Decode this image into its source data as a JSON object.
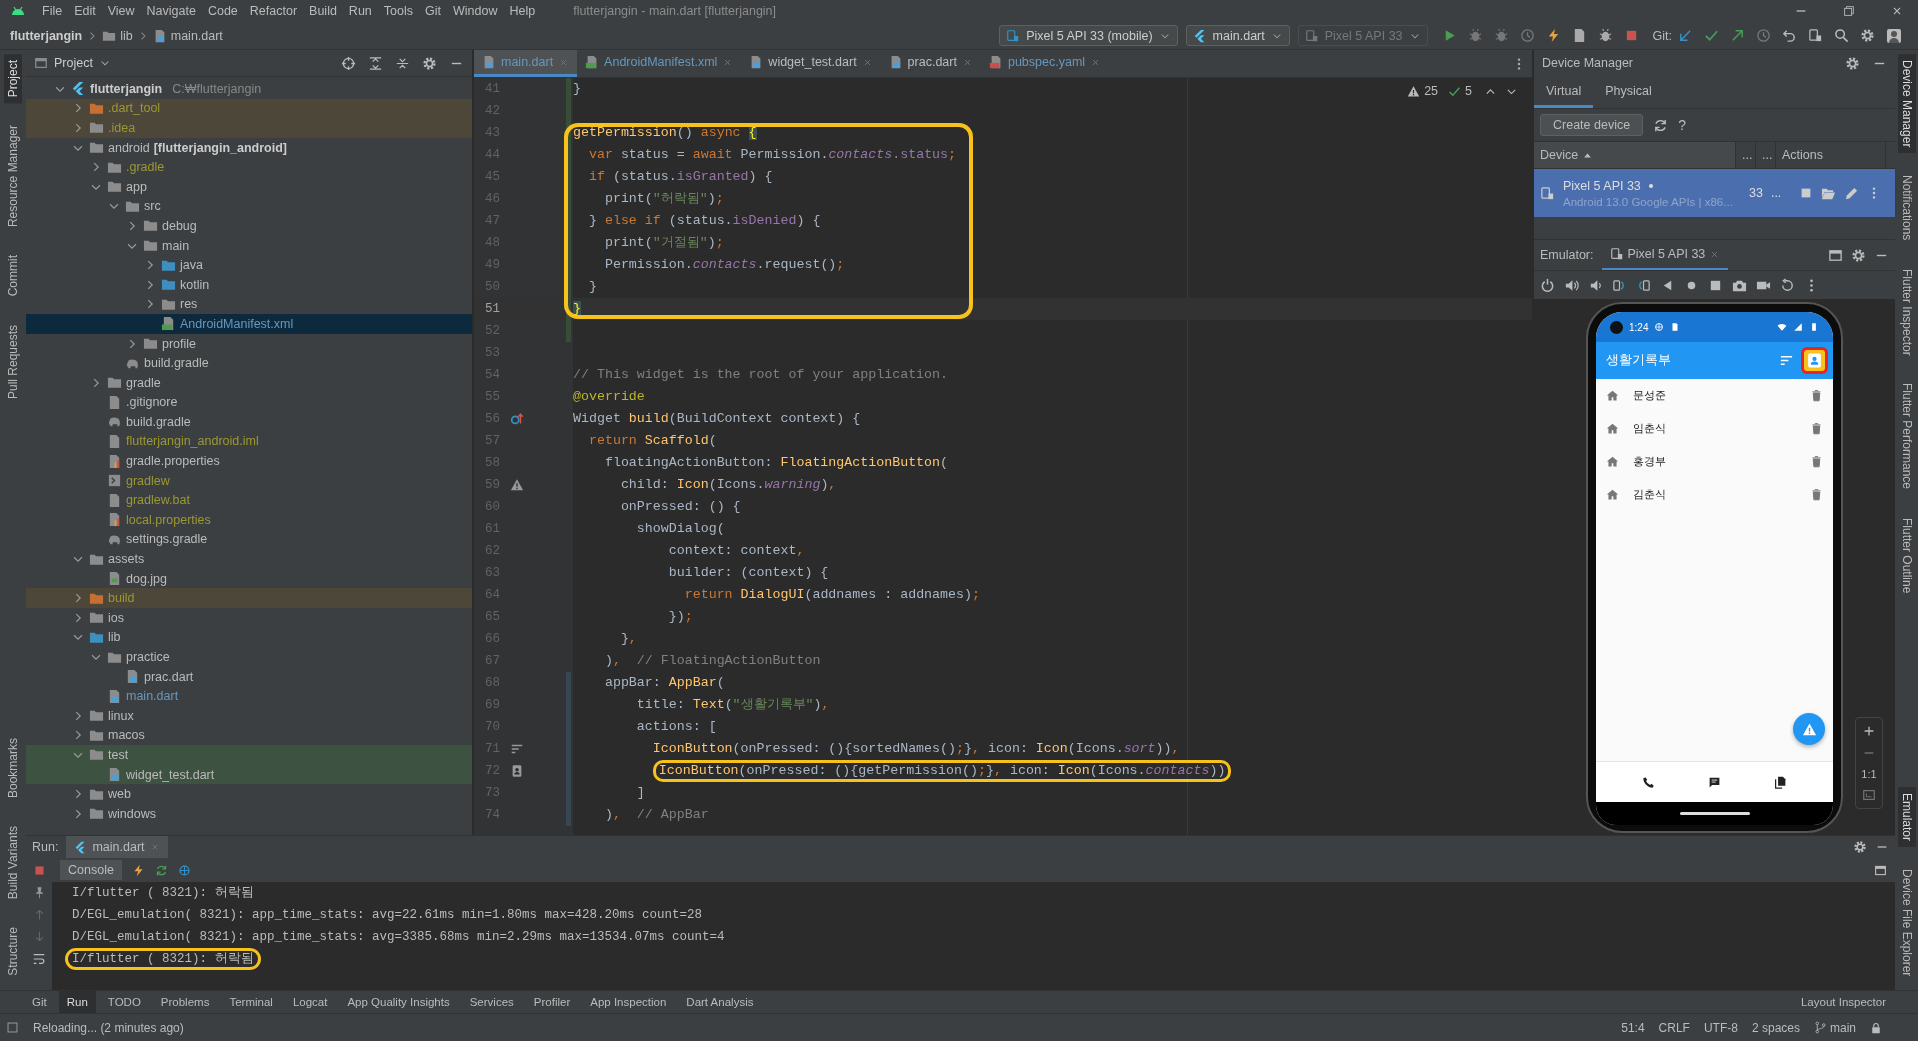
{
  "menu": {
    "items": [
      "File",
      "Edit",
      "View",
      "Navigate",
      "Code",
      "Refactor",
      "Build",
      "Run",
      "Tools",
      "Git",
      "Window",
      "Help"
    ],
    "title": "flutterjangin - main.dart [flutterjangin]"
  },
  "navbar": {
    "breadcrumbs": [
      "flutterjangin",
      "lib",
      "main.dart"
    ],
    "device": "Pixel 5 API 33 (mobile)",
    "run_config": "main.dart",
    "target": "Pixel 5 API 33",
    "git_label": "Git:"
  },
  "left_stripe": {
    "top": [
      {
        "label": "Project",
        "selected": true
      },
      {
        "label": "Resource Manager",
        "selected": false
      },
      {
        "label": "Commit",
        "selected": false
      },
      {
        "label": "Pull Requests",
        "selected": false
      }
    ],
    "bottom": [
      {
        "label": "Bookmarks",
        "selected": false
      },
      {
        "label": "Build Variants",
        "selected": false
      },
      {
        "label": "Structure",
        "selected": false
      }
    ]
  },
  "right_stripe": {
    "top": [
      {
        "label": "Device Manager",
        "selected": true
      },
      {
        "label": "Notifications",
        "selected": false
      },
      {
        "label": "Flutter Inspector",
        "selected": false
      },
      {
        "label": "Flutter Performance",
        "selected": false
      },
      {
        "label": "Flutter Outline",
        "selected": false
      }
    ],
    "bottom": [
      {
        "label": "Emulator",
        "selected": true
      },
      {
        "label": "Device File Explorer",
        "selected": false
      }
    ]
  },
  "project": {
    "title": "Project",
    "tree": [
      {
        "name": "flutterjangin",
        "path": "C:₩flutterjangin",
        "kind": "root",
        "ignored": false,
        "modified": false,
        "excluded": false,
        "test": false,
        "expanded": true,
        "selected": false,
        "children": [
          {
            "name": ".dart_tool",
            "kind": "excluded",
            "ignored": true,
            "modified": false,
            "excluded": true,
            "test": false,
            "expanded": false,
            "selected": false
          },
          {
            "name": ".idea",
            "kind": "folder",
            "ignored": true,
            "modified": false,
            "excluded": true,
            "test": false,
            "expanded": false,
            "selected": false
          },
          {
            "name": "android",
            "suffix": "[flutterjangin_android]",
            "kind": "module",
            "ignored": false,
            "modified": false,
            "excluded": false,
            "test": false,
            "expanded": true,
            "selected": false,
            "children": [
              {
                "name": ".gradle",
                "kind": "folder",
                "ignored": true,
                "modified": false,
                "excluded": false,
                "test": false,
                "expanded": false,
                "selected": false
              },
              {
                "name": "app",
                "kind": "folder",
                "ignored": false,
                "modified": false,
                "excluded": false,
                "test": false,
                "expanded": true,
                "selected": false,
                "children": [
                  {
                    "name": "src",
                    "kind": "folder",
                    "ignored": false,
                    "modified": false,
                    "excluded": false,
                    "test": false,
                    "expanded": true,
                    "selected": false,
                    "children": [
                      {
                        "name": "debug",
                        "kind": "folder",
                        "ignored": false,
                        "modified": false,
                        "excluded": false,
                        "test": false,
                        "expanded": false,
                        "selected": false
                      },
                      {
                        "name": "main",
                        "kind": "folder",
                        "ignored": false,
                        "modified": false,
                        "excluded": false,
                        "test": false,
                        "expanded": true,
                        "selected": false,
                        "children": [
                          {
                            "name": "java",
                            "kind": "source",
                            "ignored": false,
                            "modified": false,
                            "excluded": false,
                            "test": false,
                            "expanded": false,
                            "selected": false
                          },
                          {
                            "name": "kotlin",
                            "kind": "source",
                            "ignored": false,
                            "modified": false,
                            "excluded": false,
                            "test": false,
                            "expanded": false,
                            "selected": false
                          },
                          {
                            "name": "res",
                            "kind": "folder",
                            "ignored": false,
                            "modified": false,
                            "excluded": false,
                            "test": false,
                            "expanded": false,
                            "selected": false
                          },
                          {
                            "name": "AndroidManifest.xml",
                            "kind": "manifest",
                            "ignored": false,
                            "modified": true,
                            "excluded": false,
                            "test": false,
                            "selected": true
                          }
                        ]
                      },
                      {
                        "name": "profile",
                        "kind": "folder",
                        "ignored": false,
                        "modified": false,
                        "excluded": false,
                        "test": false,
                        "expanded": false,
                        "selected": false
                      }
                    ]
                  },
                  {
                    "name": "build.gradle",
                    "kind": "gradle",
                    "ignored": false,
                    "modified": false,
                    "excluded": false,
                    "test": false,
                    "selected": false
                  }
                ]
              },
              {
                "name": "gradle",
                "kind": "folder",
                "ignored": false,
                "modified": false,
                "excluded": false,
                "test": false,
                "expanded": false,
                "selected": false
              },
              {
                "name": ".gitignore",
                "kind": "file",
                "ignored": false,
                "modified": false,
                "excluded": false,
                "test": false,
                "selected": false
              },
              {
                "name": "build.gradle",
                "kind": "gradle",
                "ignored": false,
                "modified": false,
                "excluded": false,
                "test": false,
                "selected": false
              },
              {
                "name": "flutterjangin_android.iml",
                "kind": "file",
                "ignored": true,
                "modified": false,
                "excluded": false,
                "test": false,
                "selected": false
              },
              {
                "name": "gradle.properties",
                "kind": "props",
                "ignored": false,
                "modified": false,
                "excluded": false,
                "test": false,
                "selected": false
              },
              {
                "name": "gradlew",
                "kind": "script",
                "ignored": true,
                "modified": false,
                "excluded": false,
                "test": false,
                "selected": false
              },
              {
                "name": "gradlew.bat",
                "kind": "file",
                "ignored": true,
                "modified": false,
                "excluded": false,
                "test": false,
                "selected": false
              },
              {
                "name": "local.properties",
                "kind": "props",
                "ignored": true,
                "modified": false,
                "excluded": false,
                "test": false,
                "selected": false
              },
              {
                "name": "settings.gradle",
                "kind": "gradle",
                "ignored": false,
                "modified": false,
                "excluded": false,
                "test": false,
                "selected": false
              }
            ]
          },
          {
            "name": "assets",
            "kind": "folder",
            "ignored": false,
            "modified": false,
            "excluded": false,
            "test": false,
            "expanded": true,
            "selected": false,
            "children": [
              {
                "name": "dog.jpg",
                "kind": "image",
                "ignored": false,
                "modified": false,
                "excluded": false,
                "test": false,
                "selected": false
              }
            ]
          },
          {
            "name": "build",
            "kind": "excluded",
            "ignored": true,
            "modified": false,
            "excluded": true,
            "test": false,
            "expanded": false,
            "selected": false
          },
          {
            "name": "ios",
            "kind": "folder",
            "ignored": false,
            "modified": false,
            "excluded": false,
            "test": false,
            "expanded": false,
            "selected": false
          },
          {
            "name": "lib",
            "kind": "source",
            "ignored": false,
            "modified": false,
            "excluded": false,
            "test": false,
            "expanded": true,
            "selected": false,
            "children": [
              {
                "name": "practice",
                "kind": "folder",
                "ignored": false,
                "modified": false,
                "excluded": false,
                "test": false,
                "expanded": true,
                "selected": false,
                "children": [
                  {
                    "name": "prac.dart",
                    "kind": "dart",
                    "ignored": false,
                    "modified": false,
                    "excluded": false,
                    "test": false,
                    "selected": false
                  }
                ]
              },
              {
                "name": "main.dart",
                "kind": "dart",
                "ignored": false,
                "modified": true,
                "excluded": false,
                "test": false,
                "selected": false
              }
            ]
          },
          {
            "name": "linux",
            "kind": "folder",
            "ignored": false,
            "modified": false,
            "excluded": false,
            "test": false,
            "expanded": false,
            "selected": false
          },
          {
            "name": "macos",
            "kind": "folder",
            "ignored": false,
            "modified": false,
            "excluded": false,
            "test": false,
            "expanded": false,
            "selected": false
          },
          {
            "name": "test",
            "kind": "folder",
            "ignored": false,
            "modified": false,
            "excluded": false,
            "test": true,
            "expanded": true,
            "selected": false,
            "children": [
              {
                "name": "widget_test.dart",
                "kind": "dart",
                "ignored": false,
                "modified": false,
                "excluded": false,
                "test": true,
                "selected": false
              }
            ]
          },
          {
            "name": "web",
            "kind": "folder",
            "ignored": false,
            "modified": false,
            "excluded": false,
            "test": false,
            "expanded": false,
            "selected": false
          },
          {
            "name": "windows",
            "kind": "folder",
            "ignored": false,
            "modified": false,
            "excluded": false,
            "test": false,
            "expanded": false,
            "selected": false
          }
        ]
      }
    ]
  },
  "editor": {
    "tabs": [
      {
        "label": "main.dart",
        "kind": "dart",
        "modified": true,
        "selected": true
      },
      {
        "label": "AndroidManifest.xml",
        "kind": "manifest",
        "modified": true,
        "selected": false
      },
      {
        "label": "widget_test.dart",
        "kind": "dart",
        "modified": false,
        "selected": false
      },
      {
        "label": "prac.dart",
        "kind": "dart",
        "modified": false,
        "selected": false
      },
      {
        "label": "pubspec.yaml",
        "kind": "yaml",
        "modified": true,
        "selected": false
      }
    ],
    "inspections": {
      "warnings": "25",
      "passed": "5"
    },
    "lines": [
      {
        "n": "41",
        "kind": "plain",
        "added": true,
        "changed": false,
        "current": false,
        "in_box": false,
        "marked": false,
        "code": [
          {
            "text": "}",
            "kind": "plain"
          }
        ]
      },
      {
        "n": "42",
        "kind": "plain",
        "added": true,
        "changed": false,
        "current": false,
        "in_box": false,
        "marked": false
      },
      {
        "n": "43",
        "kind": "plain",
        "added": true,
        "changed": false,
        "current": false,
        "in_box": true,
        "marked": false,
        "code": [
          {
            "text": "getPermission",
            "kind": "function"
          },
          {
            "text": "() ",
            "kind": "plain"
          },
          {
            "text": "async",
            "kind": "keyword"
          },
          {
            "text": " {",
            "kind": "brace"
          }
        ]
      },
      {
        "n": "44",
        "kind": "plain",
        "added": true,
        "changed": false,
        "current": false,
        "in_box": true,
        "marked": false,
        "code": [
          {
            "text": "  var",
            "kind": "keyword"
          },
          {
            "text": " status = ",
            "kind": "plain"
          },
          {
            "text": "await",
            "kind": "keyword"
          },
          {
            "text": " Permission.",
            "kind": "plain"
          },
          {
            "text": "contacts",
            "kind": "italic_field"
          },
          {
            "text": ".status",
            "kind": "field"
          },
          {
            "text": ";",
            "kind": "keyword"
          }
        ]
      },
      {
        "n": "45",
        "kind": "plain",
        "added": true,
        "changed": false,
        "current": false,
        "in_box": true,
        "marked": false,
        "code": [
          {
            "text": "  if",
            "kind": "keyword"
          },
          {
            "text": " (status.",
            "kind": "plain"
          },
          {
            "text": "isGranted",
            "kind": "field"
          },
          {
            "text": ") {",
            "kind": "plain"
          }
        ]
      },
      {
        "n": "46",
        "kind": "plain",
        "added": true,
        "changed": false,
        "current": false,
        "in_box": true,
        "marked": false,
        "code": [
          {
            "text": "    print(",
            "kind": "plain"
          },
          {
            "text": "\"허락됨\"",
            "kind": "string"
          },
          {
            "text": ")",
            "kind": "plain"
          },
          {
            "text": ";",
            "kind": "keyword"
          }
        ]
      },
      {
        "n": "47",
        "kind": "plain",
        "added": true,
        "changed": false,
        "current": false,
        "in_box": true,
        "marked": false,
        "code": [
          {
            "text": "  } ",
            "kind": "plain"
          },
          {
            "text": "else if",
            "kind": "keyword"
          },
          {
            "text": " (status.",
            "kind": "plain"
          },
          {
            "text": "isDenied",
            "kind": "field"
          },
          {
            "text": ") {",
            "kind": "plain"
          }
        ]
      },
      {
        "n": "48",
        "kind": "plain",
        "added": true,
        "changed": false,
        "current": false,
        "in_box": true,
        "marked": false,
        "code": [
          {
            "text": "    print(",
            "kind": "plain"
          },
          {
            "text": "\"거절됨\"",
            "kind": "string"
          },
          {
            "text": ")",
            "kind": "plain"
          },
          {
            "text": ";",
            "kind": "keyword"
          }
        ]
      },
      {
        "n": "49",
        "kind": "plain",
        "added": true,
        "changed": false,
        "current": false,
        "in_box": true,
        "marked": false,
        "code": [
          {
            "text": "    Permission.",
            "kind": "plain"
          },
          {
            "text": "contacts",
            "kind": "italic_field"
          },
          {
            "text": ".request()",
            "kind": "plain"
          },
          {
            "text": ";",
            "kind": "keyword"
          }
        ]
      },
      {
        "n": "50",
        "kind": "plain",
        "added": true,
        "changed": false,
        "current": false,
        "in_box": true,
        "marked": false,
        "code": [
          {
            "text": "  }",
            "kind": "plain"
          }
        ]
      },
      {
        "n": "51",
        "kind": "plain",
        "added": true,
        "changed": false,
        "current": true,
        "in_box": true,
        "marked": false,
        "code": [
          {
            "text": "}",
            "kind": "brace"
          }
        ]
      },
      {
        "n": "52",
        "kind": "plain",
        "added": true,
        "changed": false,
        "current": false,
        "in_box": false,
        "marked": false
      },
      {
        "n": "53",
        "kind": "plain",
        "added": false,
        "changed": false,
        "current": false,
        "in_box": false,
        "marked": false
      },
      {
        "n": "54",
        "kind": "plain",
        "added": false,
        "changed": false,
        "current": false,
        "in_box": false,
        "marked": false,
        "code": [
          {
            "text": "// This widget is the root of your application.",
            "kind": "comment"
          }
        ]
      },
      {
        "n": "55",
        "kind": "plain",
        "added": false,
        "changed": false,
        "current": false,
        "in_box": false,
        "marked": false,
        "code": [
          {
            "text": "@override",
            "kind": "annotation"
          }
        ]
      },
      {
        "n": "56",
        "kind": "override",
        "added": false,
        "changed": false,
        "current": false,
        "in_box": false,
        "marked": false,
        "code": [
          {
            "text": "Widget ",
            "kind": "plain"
          },
          {
            "text": "build",
            "kind": "function"
          },
          {
            "text": "(BuildContext context) {",
            "kind": "plain"
          }
        ]
      },
      {
        "n": "57",
        "kind": "plain",
        "added": false,
        "changed": false,
        "current": false,
        "in_box": false,
        "marked": false,
        "code": [
          {
            "text": "  return",
            "kind": "keyword"
          },
          {
            "text": " Scaffold",
            "kind": "function"
          },
          {
            "text": "(",
            "kind": "plain"
          }
        ]
      },
      {
        "n": "58",
        "kind": "plain",
        "added": false,
        "changed": false,
        "current": false,
        "in_box": false,
        "marked": false,
        "code": [
          {
            "text": "    floatingActionButton: ",
            "kind": "plain"
          },
          {
            "text": "FloatingActionButton",
            "kind": "function"
          },
          {
            "text": "(",
            "kind": "plain"
          }
        ]
      },
      {
        "n": "59",
        "kind": "warning",
        "added": false,
        "changed": false,
        "current": false,
        "in_box": false,
        "marked": false,
        "code": [
          {
            "text": "      child: ",
            "kind": "plain"
          },
          {
            "text": "Icon",
            "kind": "function"
          },
          {
            "text": "(Icons.",
            "kind": "plain"
          },
          {
            "text": "warning",
            "kind": "italic_field"
          },
          {
            "text": ")",
            "kind": "plain"
          },
          {
            "text": ",",
            "kind": "keyword"
          }
        ]
      },
      {
        "n": "60",
        "kind": "plain",
        "added": false,
        "changed": false,
        "current": false,
        "in_box": false,
        "marked": false,
        "code": [
          {
            "text": "      onPressed: () {",
            "kind": "plain"
          }
        ]
      },
      {
        "n": "61",
        "kind": "plain",
        "added": false,
        "changed": false,
        "current": false,
        "in_box": false,
        "marked": false,
        "code": [
          {
            "text": "        showDialog(",
            "kind": "plain"
          }
        ]
      },
      {
        "n": "62",
        "kind": "plain",
        "added": false,
        "changed": false,
        "current": false,
        "in_box": false,
        "marked": false,
        "code": [
          {
            "text": "            context: context",
            "kind": "plain"
          },
          {
            "text": ",",
            "kind": "keyword"
          }
        ]
      },
      {
        "n": "63",
        "kind": "plain",
        "added": false,
        "changed": false,
        "current": false,
        "in_box": false,
        "marked": false,
        "code": [
          {
            "text": "            builder: (context) {",
            "kind": "plain"
          }
        ]
      },
      {
        "n": "64",
        "kind": "plain",
        "added": false,
        "changed": false,
        "current": false,
        "in_box": false,
        "marked": false,
        "code": [
          {
            "text": "              return",
            "kind": "keyword"
          },
          {
            "text": " DialogUI",
            "kind": "function"
          },
          {
            "text": "(addnames : addnames)",
            "kind": "plain"
          },
          {
            "text": ";",
            "kind": "keyword"
          }
        ]
      },
      {
        "n": "65",
        "kind": "plain",
        "added": false,
        "changed": false,
        "current": false,
        "in_box": false,
        "marked": false,
        "code": [
          {
            "text": "            })",
            "kind": "plain"
          },
          {
            "text": ";",
            "kind": "keyword"
          }
        ]
      },
      {
        "n": "66",
        "kind": "plain",
        "added": false,
        "changed": false,
        "current": false,
        "in_box": false,
        "marked": false,
        "code": [
          {
            "text": "      }",
            "kind": "plain"
          },
          {
            "text": ",",
            "kind": "keyword"
          }
        ]
      },
      {
        "n": "67",
        "kind": "plain",
        "added": false,
        "changed": false,
        "current": false,
        "in_box": false,
        "marked": false,
        "code": [
          {
            "text": "    )",
            "kind": "plain"
          },
          {
            "text": ",",
            "kind": "keyword"
          },
          {
            "text": "  // FloatingActionButton",
            "kind": "comment"
          }
        ]
      },
      {
        "n": "68",
        "kind": "plain",
        "added": false,
        "changed": true,
        "current": false,
        "in_box": false,
        "marked": false,
        "code": [
          {
            "text": "    appBar: ",
            "kind": "plain"
          },
          {
            "text": "AppBar",
            "kind": "function"
          },
          {
            "text": "(",
            "kind": "plain"
          }
        ]
      },
      {
        "n": "69",
        "kind": "plain",
        "added": false,
        "changed": true,
        "current": false,
        "in_box": false,
        "marked": false,
        "code": [
          {
            "text": "        title: ",
            "kind": "plain"
          },
          {
            "text": "Text",
            "kind": "function"
          },
          {
            "text": "(",
            "kind": "plain"
          },
          {
            "text": "\"생활기록부\"",
            "kind": "string"
          },
          {
            "text": ")",
            "kind": "plain"
          },
          {
            "text": ",",
            "kind": "keyword"
          }
        ]
      },
      {
        "n": "70",
        "kind": "plain",
        "added": false,
        "changed": true,
        "current": false,
        "in_box": false,
        "marked": false,
        "code": [
          {
            "text": "        actions: [",
            "kind": "plain"
          }
        ]
      },
      {
        "n": "71",
        "kind": "sort",
        "added": false,
        "changed": true,
        "current": false,
        "in_box": false,
        "marked": false,
        "code": [
          {
            "text": "          IconButton",
            "kind": "function"
          },
          {
            "text": "(onPressed: (){sortedNames()",
            "kind": "plain"
          },
          {
            "text": ";",
            "kind": "keyword"
          },
          {
            "text": "}",
            "kind": "plain"
          },
          {
            "text": ",",
            "kind": "keyword"
          },
          {
            "text": " icon: ",
            "kind": "plain"
          },
          {
            "text": "Icon",
            "kind": "function"
          },
          {
            "text": "(Icons.",
            "kind": "plain"
          },
          {
            "text": "sort",
            "kind": "italic_field"
          },
          {
            "text": "))",
            "kind": "plain"
          },
          {
            "text": ",",
            "kind": "keyword"
          }
        ]
      },
      {
        "n": "72",
        "kind": "contacts",
        "added": false,
        "changed": true,
        "current": false,
        "in_box": false,
        "marked": true,
        "code": [
          {
            "text": "          IconButton",
            "kind": "function"
          },
          {
            "text": "(onPressed: (){getPermission()",
            "kind": "plain"
          },
          {
            "text": ";",
            "kind": "keyword"
          },
          {
            "text": "}",
            "kind": "plain"
          },
          {
            "text": ",",
            "kind": "keyword"
          },
          {
            "text": " icon: ",
            "kind": "plain"
          },
          {
            "text": "Icon",
            "kind": "function"
          },
          {
            "text": "(Icons.",
            "kind": "plain"
          },
          {
            "text": "contacts",
            "kind": "italic_field"
          },
          {
            "text": "))",
            "kind": "plain"
          }
        ]
      },
      {
        "n": "73",
        "kind": "plain",
        "added": false,
        "changed": true,
        "current": false,
        "in_box": false,
        "marked": false,
        "code": [
          {
            "text": "        ]",
            "kind": "plain"
          }
        ]
      },
      {
        "n": "74",
        "kind": "plain",
        "added": false,
        "changed": true,
        "current": false,
        "in_box": false,
        "marked": false,
        "code": [
          {
            "text": "    )",
            "kind": "plain"
          },
          {
            "text": ",",
            "kind": "keyword"
          },
          {
            "text": "  // AppBar",
            "kind": "comment"
          }
        ]
      }
    ]
  },
  "device_manager": {
    "title": "Device Manager",
    "tabs": [
      {
        "label": "Virtual",
        "selected": true
      },
      {
        "label": "Physical",
        "selected": false
      }
    ],
    "create_button": "Create device",
    "help": "?",
    "columns": [
      {
        "label": "Device",
        "sorted": true
      },
      {
        "label": "..."
      },
      {
        "label": "..."
      },
      {
        "label": "Actions"
      }
    ],
    "rows": [
      {
        "name": "Pixel 5 API 33",
        "detail": "Android 13.0 Google APIs | x86...",
        "api": "33",
        "column_3": "...",
        "running": true,
        "selected": true
      }
    ]
  },
  "emulator": {
    "label": "Emulator:",
    "tab": "Pixel 5 API 33",
    "zoom_label": "1:1",
    "phone": {
      "time": "1:24",
      "app_title": "생활기록부",
      "contacts_marked": true,
      "items": [
        "문성준",
        "임춘식",
        "홍경부",
        "김춘식"
      ]
    }
  },
  "run": {
    "label": "Run:",
    "tab": "main.dart",
    "console_tab": "Console",
    "lines": [
      {
        "text": "I/flutter ( 8321): 허락됨",
        "marked": false
      },
      {
        "text": "D/EGL_emulation( 8321): app_time_stats: avg=22.61ms min=1.80ms max=428.20ms count=28",
        "marked": false
      },
      {
        "text": "D/EGL_emulation( 8321): app_time_stats: avg=3385.68ms min=2.29ms max=13534.07ms count=4",
        "marked": false
      },
      {
        "text": "I/flutter ( 8321): 허락됨",
        "marked": true
      }
    ]
  },
  "tool_windows": {
    "left": [
      {
        "label": "Git",
        "selected": false
      },
      {
        "label": "Run",
        "selected": true
      },
      {
        "label": "TODO",
        "selected": false
      },
      {
        "label": "Problems",
        "selected": false
      },
      {
        "label": "Terminal",
        "selected": false
      },
      {
        "label": "Logcat",
        "selected": false
      },
      {
        "label": "App Quality Insights",
        "selected": false
      },
      {
        "label": "Services",
        "selected": false
      },
      {
        "label": "Profiler",
        "selected": false
      },
      {
        "label": "App Inspection",
        "selected": false
      },
      {
        "label": "Dart Analysis",
        "selected": false
      }
    ],
    "right": [
      {
        "label": "Layout Inspector",
        "selected": false
      }
    ]
  },
  "status": {
    "message": "Reloading... (2 minutes ago)",
    "items": [
      "51:4",
      "CRLF",
      "UTF-8",
      "2 spaces"
    ],
    "branch": "main"
  }
}
